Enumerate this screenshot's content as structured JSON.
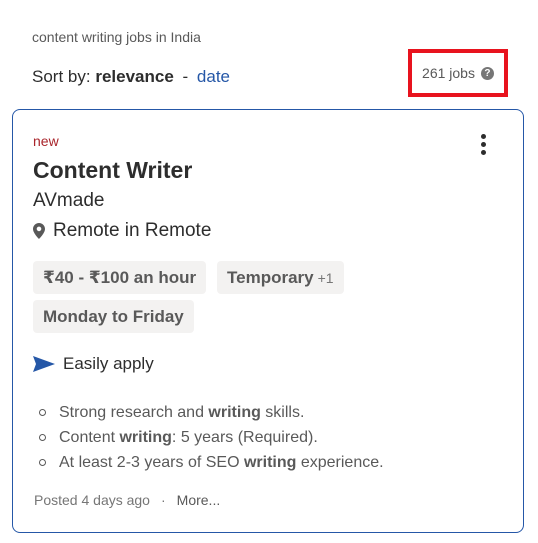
{
  "search": {
    "query_label": "content writing jobs in India"
  },
  "sort": {
    "prefix": "Sort by:",
    "active": "relevance",
    "separator": "-",
    "alternate": "date"
  },
  "results": {
    "count_label": "261 jobs",
    "help_glyph": "?"
  },
  "job": {
    "tag": "new",
    "title": "Content Writer",
    "company": "AVmade",
    "location": "Remote in Remote",
    "chips": {
      "salary": "₹40 - ₹100 an hour",
      "type": "Temporary",
      "type_extra": "+1",
      "schedule": "Monday to Friday"
    },
    "apply_label": "Easily apply",
    "snippets": [
      {
        "pre": "Strong research and ",
        "bold": "writing",
        "post": " skills."
      },
      {
        "pre": "Content ",
        "bold": "writing",
        "post": ": 5 years (Required)."
      },
      {
        "pre": "At least 2-3 years of SEO ",
        "bold": "writing",
        "post": " experience."
      }
    ],
    "posted": "Posted 4 days ago",
    "footer_dot": "·",
    "more_label": "More..."
  },
  "colors": {
    "accent": "#2557a7",
    "new_tag": "#a9252b",
    "highlight_box": "#e8131e",
    "chip_bg": "#f3f2f1"
  },
  "icons": [
    "help-icon",
    "kebab-menu-icon",
    "location-pin-icon",
    "send-arrow-icon"
  ]
}
